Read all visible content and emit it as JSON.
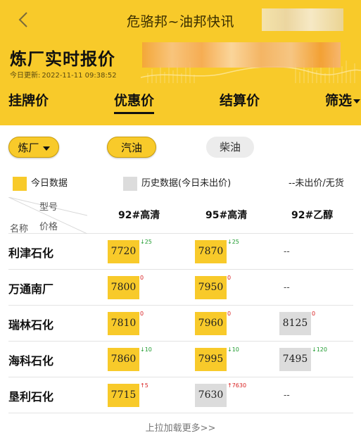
{
  "nav": {
    "title": "危骆邦~油邦快讯",
    "back_icon": "chevron-left-icon"
  },
  "header": {
    "title": "炼厂实时报价",
    "update_label": "今日更新:",
    "update_time": "2022-11-11 09:38:52"
  },
  "tabs": [
    {
      "label": "挂牌价",
      "active": false
    },
    {
      "label": "优惠价",
      "active": true
    },
    {
      "label": "结算价",
      "active": false
    },
    {
      "label": "筛选",
      "active": false
    }
  ],
  "filters": {
    "refinery_label": "炼厂",
    "gasoline_label": "汽油",
    "diesel_label": "柴油"
  },
  "legend": {
    "today": "今日数据",
    "history": "历史数据(今日未出价)",
    "none": "--未出价/无货"
  },
  "colors": {
    "accent": "#f8ca2a",
    "history": "#dcdcdc",
    "up": "#d81e1e",
    "down": "#1e9b2e"
  },
  "table": {
    "corner": {
      "type": "型号",
      "name": "名称",
      "price": "价格"
    },
    "columns": [
      "92#高清",
      "95#高清",
      "92#乙醇"
    ],
    "rows": [
      {
        "name": "利津石化",
        "cells": [
          {
            "price": "7720",
            "kind": "today",
            "change": "↓25",
            "dir": "down"
          },
          {
            "price": "7870",
            "kind": "today",
            "change": "↓25",
            "dir": "down"
          },
          {
            "empty": "--"
          }
        ]
      },
      {
        "name": "万通南厂",
        "cells": [
          {
            "price": "7800",
            "kind": "today",
            "change": "0",
            "dir": "up"
          },
          {
            "price": "7950",
            "kind": "today",
            "change": "0",
            "dir": "up"
          },
          {
            "empty": "--"
          }
        ]
      },
      {
        "name": "瑞林石化",
        "cells": [
          {
            "price": "7810",
            "kind": "today",
            "change": "0",
            "dir": "up"
          },
          {
            "price": "7960",
            "kind": "today",
            "change": "0",
            "dir": "up"
          },
          {
            "price": "8125",
            "kind": "hist",
            "change": "0",
            "dir": "up"
          }
        ]
      },
      {
        "name": "海科石化",
        "cells": [
          {
            "price": "7860",
            "kind": "today",
            "change": "↓10",
            "dir": "down"
          },
          {
            "price": "7995",
            "kind": "today",
            "change": "↓10",
            "dir": "down"
          },
          {
            "price": "7495",
            "kind": "hist",
            "change": "↓120",
            "dir": "down"
          }
        ]
      },
      {
        "name": "垦利石化",
        "cells": [
          {
            "price": "7715",
            "kind": "today",
            "change": "↑5",
            "dir": "up"
          },
          {
            "price": "7630",
            "kind": "hist",
            "change": "↑7630",
            "dir": "up"
          },
          {
            "empty": "--"
          }
        ]
      }
    ]
  },
  "load_more": "上拉加载更多>>"
}
